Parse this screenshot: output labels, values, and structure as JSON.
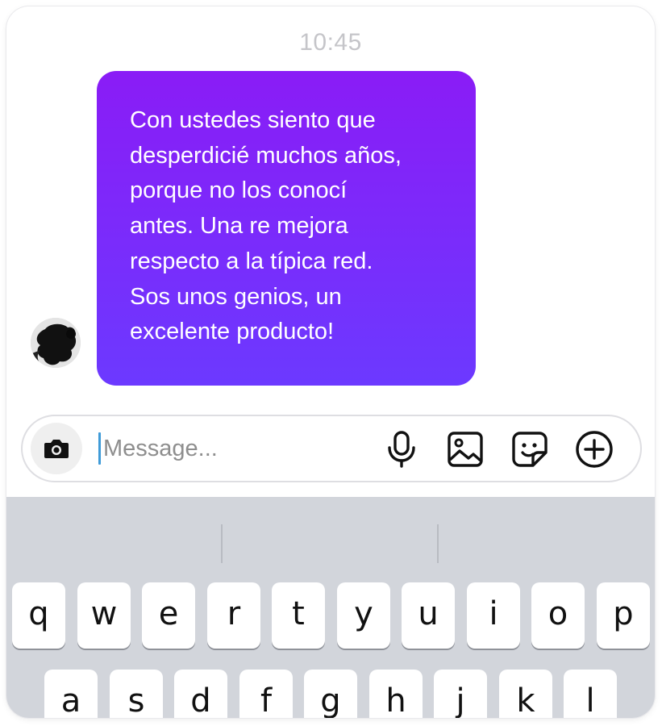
{
  "chat": {
    "timestamp": "10:45",
    "message": "Con ustedes siento que\ndesperdicié muchos años,\nporque no los conocí\nantes. Una re mejora\nrespecto a la típica red.\nSos unos genios, un\nexcelente producto!",
    "bubble_gradient": [
      "#8a1cf6",
      "#6c39ff"
    ]
  },
  "composer": {
    "placeholder": "Message...",
    "value": "",
    "buttons": {
      "camera": "camera-icon",
      "microphone": "microphone-icon",
      "gallery": "image-icon",
      "sticker": "sticker-icon",
      "more": "plus-icon"
    }
  },
  "keyboard": {
    "row1": [
      "q",
      "w",
      "e",
      "r",
      "t",
      "y",
      "u",
      "i",
      "o",
      "p"
    ],
    "row2": [
      "a",
      "s",
      "d",
      "f",
      "g",
      "h",
      "j",
      "k",
      "l"
    ]
  }
}
